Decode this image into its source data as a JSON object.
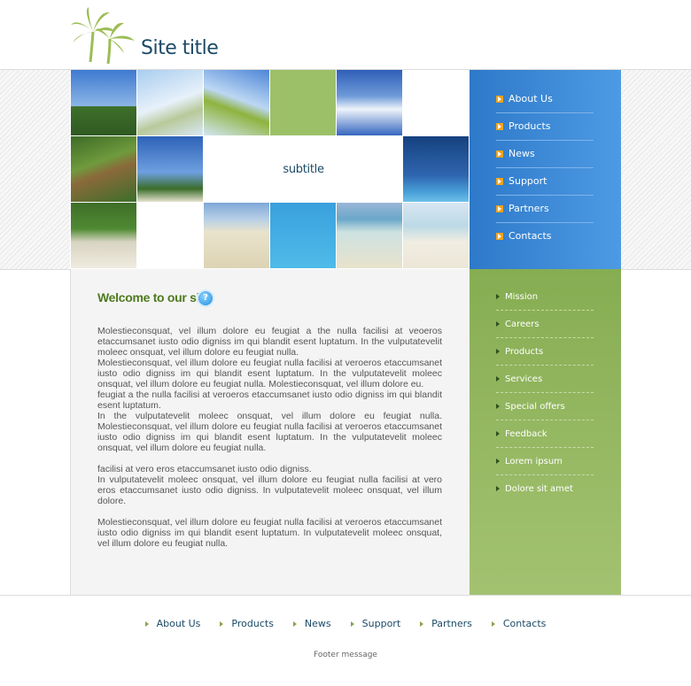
{
  "header": {
    "site_title": "Site title",
    "subtitle": "subtitle"
  },
  "top_nav": [
    {
      "label": "About Us"
    },
    {
      "label": "Products"
    },
    {
      "label": "News"
    },
    {
      "label": "Support"
    },
    {
      "label": "Partners"
    },
    {
      "label": "Contacts"
    }
  ],
  "main": {
    "welcome_title": "Welcome to our site",
    "paragraphs": [
      "Molestieconsquat, vel illum dolore eu feugiat a the nulla facilisi at veoeros etaccumsanet iusto odio digniss im qui blandit esent luptatum. In the vulputatevelit moleec onsquat, vel illum dolore eu feugiat nulla.\nMolestieconsquat, vel illum dolore eu feugiat nulla facilisi at veroeros etaccumsanet iusto odio digniss im qui blandit esent luptatum. In the vulputatevelit moleec onsquat, vel illum dolore eu feugiat nulla. Molestieconsquat, vel illum dolore eu.\n feugiat a the nulla facilisi at veroeros etaccumsanet iusto odio digniss im qui blandit esent luptatum.\n  In the vulputatevelit moleec onsquat, vel illum dolore eu feugiat nulla. Molestieconsquat, vel illum dolore eu feugiat nulla facilisi at veroeros etaccumsanet iusto odio digniss im qui blandit esent luptatum. In the vulputatevelit moleec onsquat, vel illum dolore eu feugiat nulla.",
      "facilisi at vero eros etaccumsanet iusto odio digniss.\nIn vulputatevelit moleec onsquat, vel illum dolore eu feugiat nulla facilisi at vero eros etaccumsanet iusto odio digniss. In vulputatevelit moleec onsquat, vel illum dolore.",
      "Molestieconsquat, vel illum dolore eu feugiat nulla facilisi at veroeros etaccumsanet iusto odio digniss im qui blandit esent luptatum. In vulputatevelit moleec onsquat, vel illum dolore eu feugiat nulla."
    ]
  },
  "side_nav": [
    {
      "label": "Mission"
    },
    {
      "label": "Careers"
    },
    {
      "label": "Products"
    },
    {
      "label": "Services"
    },
    {
      "label": "Special offers"
    },
    {
      "label": "Feedback"
    },
    {
      "label": "Lorem ipsum"
    },
    {
      "label": "Dolore sit amet"
    }
  ],
  "footer": {
    "links": [
      {
        "label": "About Us"
      },
      {
        "label": "Products"
      },
      {
        "label": "News"
      },
      {
        "label": "Support"
      },
      {
        "label": "Partners"
      },
      {
        "label": "Contacts"
      }
    ],
    "message": "Footer message"
  },
  "colors": {
    "top_nav_blue": "#3a87d6",
    "side_nav_green": "#93b65f",
    "welcome_green": "#4e7a1e",
    "title_navy": "#1b4a66",
    "bullet_orange": "#f2a31b"
  }
}
